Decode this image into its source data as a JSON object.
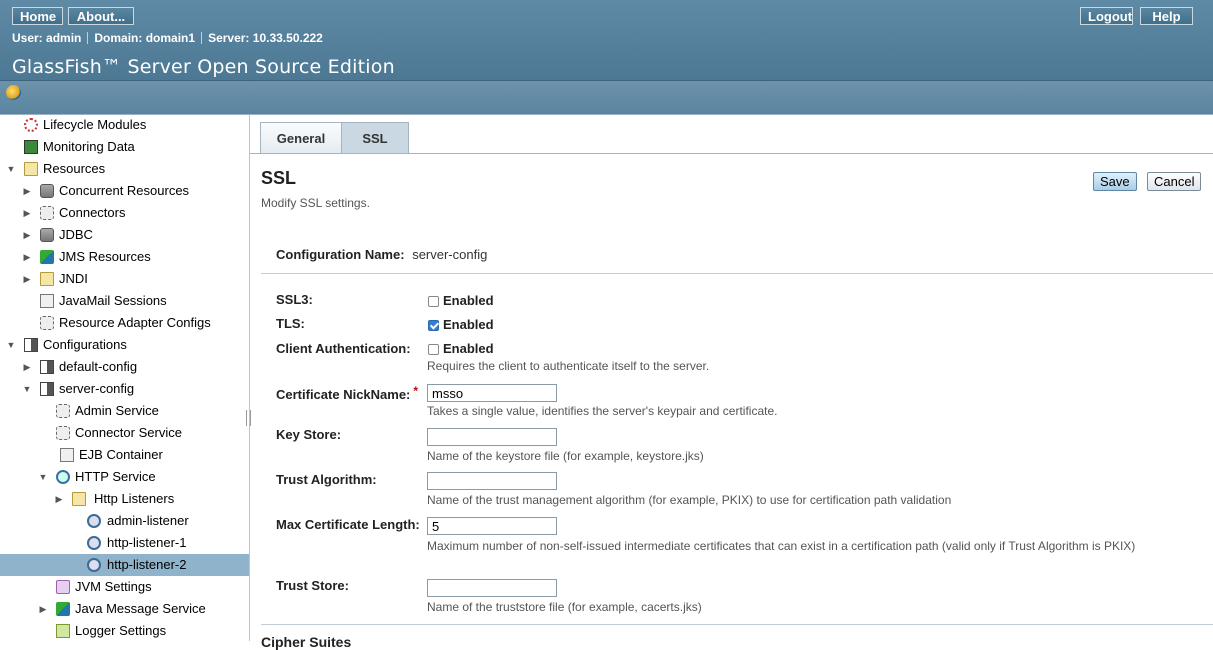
{
  "masthead": {
    "home_label": "Home",
    "about_label": "About...",
    "logout_label": "Logout",
    "help_label": "Help",
    "user_label": "User:",
    "user_value": "admin",
    "domain_label": "Domain:",
    "domain_value": "domain1",
    "server_label": "Server:",
    "server_value": "10.33.50.222",
    "product_name": "GlassFish™ Server Open Source Edition"
  },
  "tree": {
    "items": [
      {
        "label": "Lifecycle Modules",
        "icon": "lifecycle-icon"
      },
      {
        "label": "Monitoring Data",
        "icon": "monitoring-icon"
      },
      {
        "label": "Resources",
        "icon": "resources-icon"
      },
      {
        "label": "Concurrent Resources",
        "icon": "database-icon"
      },
      {
        "label": "Connectors",
        "icon": "connector-icon"
      },
      {
        "label": "JDBC",
        "icon": "database-icon"
      },
      {
        "label": "JMS Resources",
        "icon": "jms-icon"
      },
      {
        "label": "JNDI",
        "icon": "folder-icon"
      },
      {
        "label": "JavaMail Sessions",
        "icon": "mail-icon"
      },
      {
        "label": "Resource Adapter Configs",
        "icon": "connector-icon"
      },
      {
        "label": "Configurations",
        "icon": "config-icon"
      },
      {
        "label": "default-config",
        "icon": "config-icon"
      },
      {
        "label": "server-config",
        "icon": "config-icon"
      },
      {
        "label": "Admin Service",
        "icon": "service-icon"
      },
      {
        "label": "Connector Service",
        "icon": "service-icon"
      },
      {
        "label": "EJB Container",
        "icon": "container-icon"
      },
      {
        "label": "HTTP Service",
        "icon": "http-icon"
      },
      {
        "label": "Http Listeners",
        "icon": "folder-icon"
      },
      {
        "label": "admin-listener",
        "icon": "listener-icon"
      },
      {
        "label": "http-listener-1",
        "icon": "listener-icon"
      },
      {
        "label": "http-listener-2",
        "icon": "listener-icon"
      },
      {
        "label": "JVM Settings",
        "icon": "jvm-icon"
      },
      {
        "label": "Java Message Service",
        "icon": "jms-icon"
      },
      {
        "label": "Logger Settings",
        "icon": "logger-icon"
      }
    ]
  },
  "tabs": {
    "general": "General",
    "ssl": "SSL"
  },
  "page": {
    "title": "SSL",
    "help": "Modify SSL settings.",
    "save_label": "Save",
    "cancel_label": "Cancel",
    "config_name_label": "Configuration Name:",
    "config_name_value": "server-config"
  },
  "form": {
    "ssl3_label": "SSL3:",
    "ssl3_checkbox_label": "Enabled",
    "ssl3_checked": false,
    "tls_label": "TLS:",
    "tls_checkbox_label": "Enabled",
    "tls_checked": true,
    "client_auth_label": "Client Authentication:",
    "client_auth_checkbox_label": "Enabled",
    "client_auth_checked": false,
    "client_auth_help": "Requires the client to authenticate itself to the server.",
    "cert_nick_label": "Certificate NickName:",
    "cert_nick_required": "*",
    "cert_nick_value": "msso",
    "cert_nick_help": "Takes a single value, identifies the server's keypair and certificate.",
    "key_store_label": "Key Store:",
    "key_store_value": "",
    "key_store_help": "Name of the keystore file (for example, keystore.jks)",
    "trust_alg_label": "Trust Algorithm:",
    "trust_alg_value": "",
    "trust_alg_help": "Name of the trust management algorithm (for example, PKIX) to use for certification path validation",
    "max_cert_label": "Max Certificate Length:",
    "max_cert_value": "5",
    "max_cert_help": "Maximum number of non-self-issued intermediate certificates that can exist in a certification path (valid only if Trust Algorithm is PKIX)",
    "trust_store_label": "Trust Store:",
    "trust_store_value": "",
    "trust_store_help": "Name of the truststore file (for example, cacerts.jks)",
    "cipher_suites_heading": "Cipher Suites"
  }
}
